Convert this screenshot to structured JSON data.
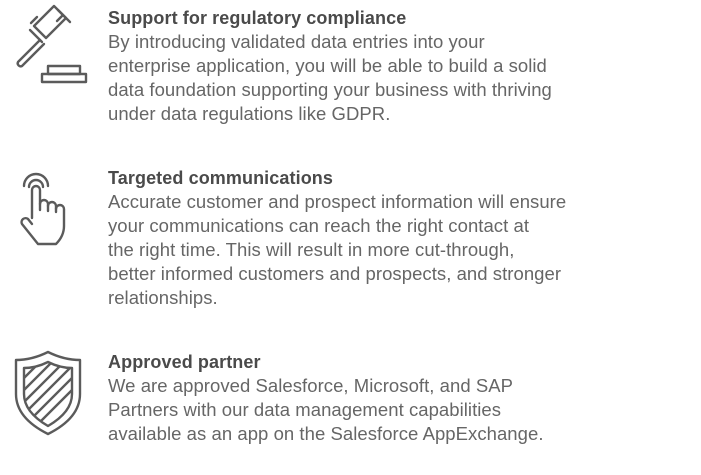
{
  "colors": {
    "heading": "#4a4a4a",
    "body_text": "#666666",
    "icon_stroke": "#5b5b5b",
    "background": "#ffffff"
  },
  "features": [
    {
      "icon": "gavel-icon",
      "title": "Support for regulatory compliance",
      "lines": [
        "By introducing validated data entries into your",
        "enterprise application, you will be able to build a solid",
        "data foundation supporting your business with thriving",
        "under data regulations like GDPR."
      ]
    },
    {
      "icon": "pointing-hand-icon",
      "title": "Targeted communications",
      "lines": [
        "Accurate customer and prospect information will ensure",
        "your communications can reach the right contact at",
        "the right time. This will result in more cut-through,",
        "better informed customers and prospects, and stronger",
        "relationships."
      ]
    },
    {
      "icon": "shield-icon",
      "title": "Approved partner",
      "lines": [
        "We are approved Salesforce, Microsoft, and SAP",
        "Partners with our data management capabilities",
        "available as an app on the Salesforce AppExchange."
      ]
    }
  ]
}
